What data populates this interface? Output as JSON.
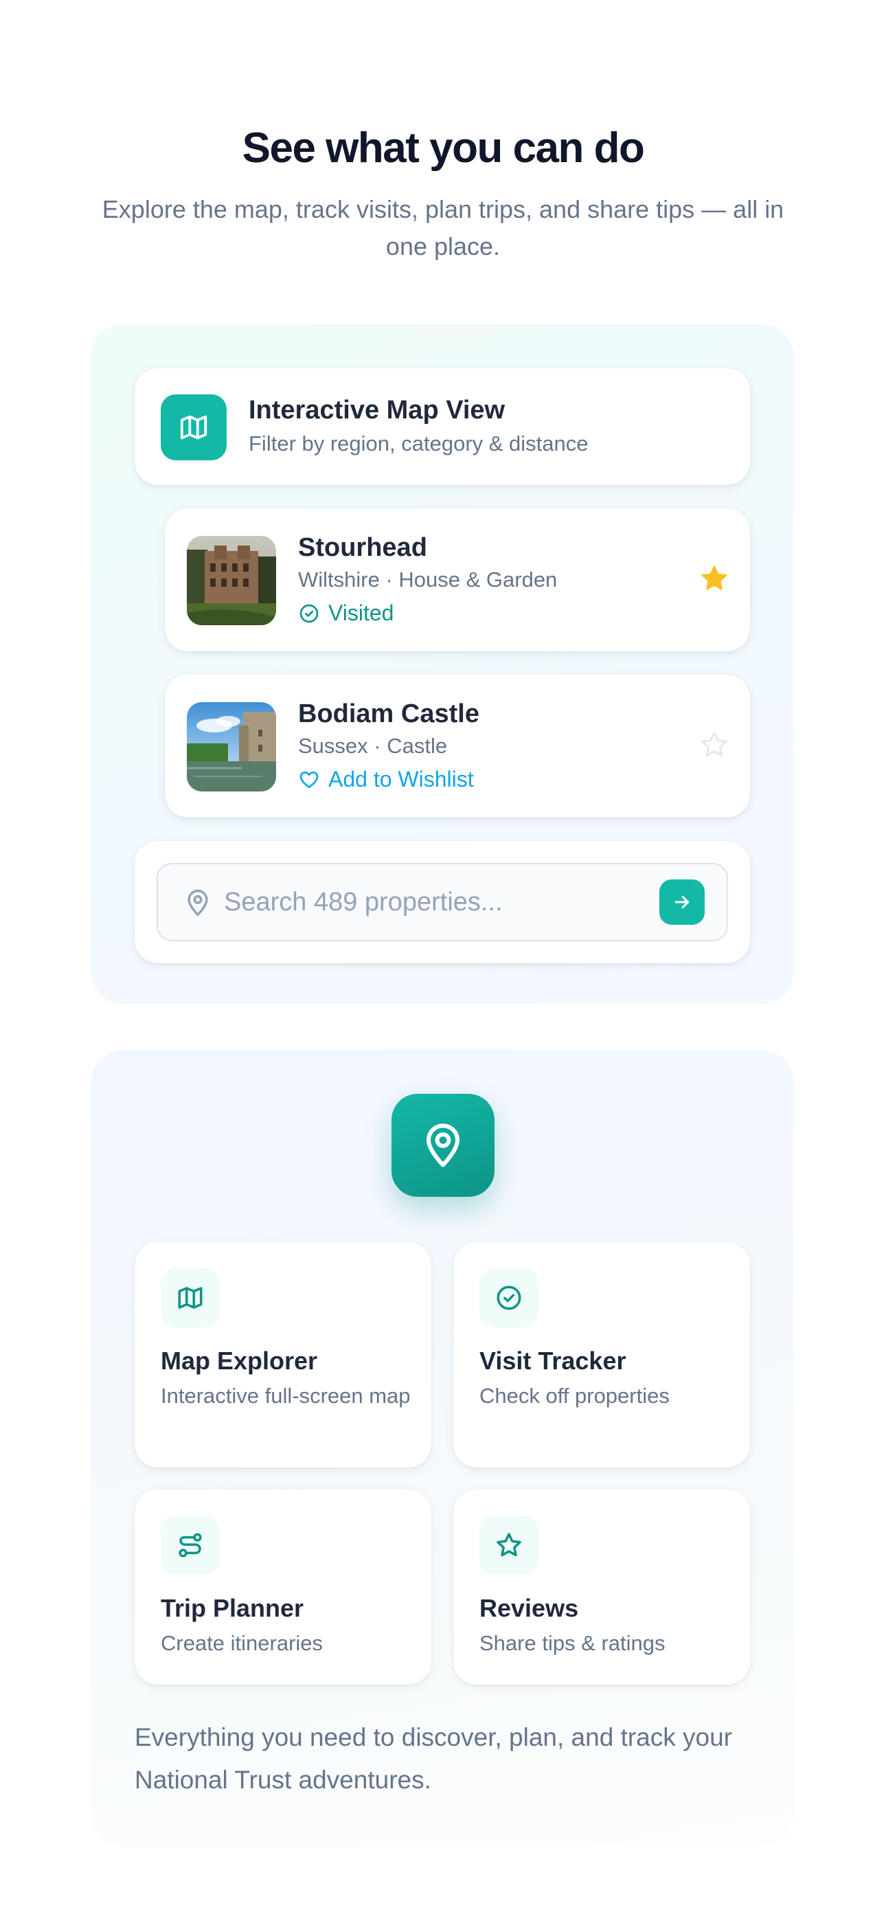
{
  "hero": {
    "title": "See what you can do",
    "subtitle": "Explore the map, track visits, plan trips, and share tips — all in one place."
  },
  "map_view": {
    "icon": "map-icon",
    "title": "Interactive Map View",
    "subtitle": "Filter by region, category & distance"
  },
  "properties": [
    {
      "name": "Stourhead",
      "meta": "Wiltshire · House & Garden",
      "status_label": "Visited",
      "status_icon": "check-circle-icon",
      "starred": true
    },
    {
      "name": "Bodiam Castle",
      "meta": "Sussex · Castle",
      "status_label": "Add to Wishlist",
      "status_icon": "heart-icon",
      "starred": false
    }
  ],
  "search": {
    "placeholder": "Search 489 properties...",
    "value": ""
  },
  "features": [
    {
      "icon": "map-icon",
      "title": "Map Explorer",
      "description": "Interactive full-screen map"
    },
    {
      "icon": "check-circle-icon",
      "title": "Visit Tracker",
      "description": "Check off properties"
    },
    {
      "icon": "route-icon",
      "title": "Trip Planner",
      "description": "Create itineraries"
    },
    {
      "icon": "star-icon",
      "title": "Reviews",
      "description": "Share tips & ratings"
    }
  ],
  "footer_text": "Everything you need to discover, plan, and track your National Trust adventures.",
  "colors": {
    "accent": "#14b8a6",
    "accent_dark": "#0d9488",
    "wishlist": "#0ea5e9",
    "star": "#fbbf24",
    "heading": "#0f172a",
    "muted": "#64748b"
  }
}
